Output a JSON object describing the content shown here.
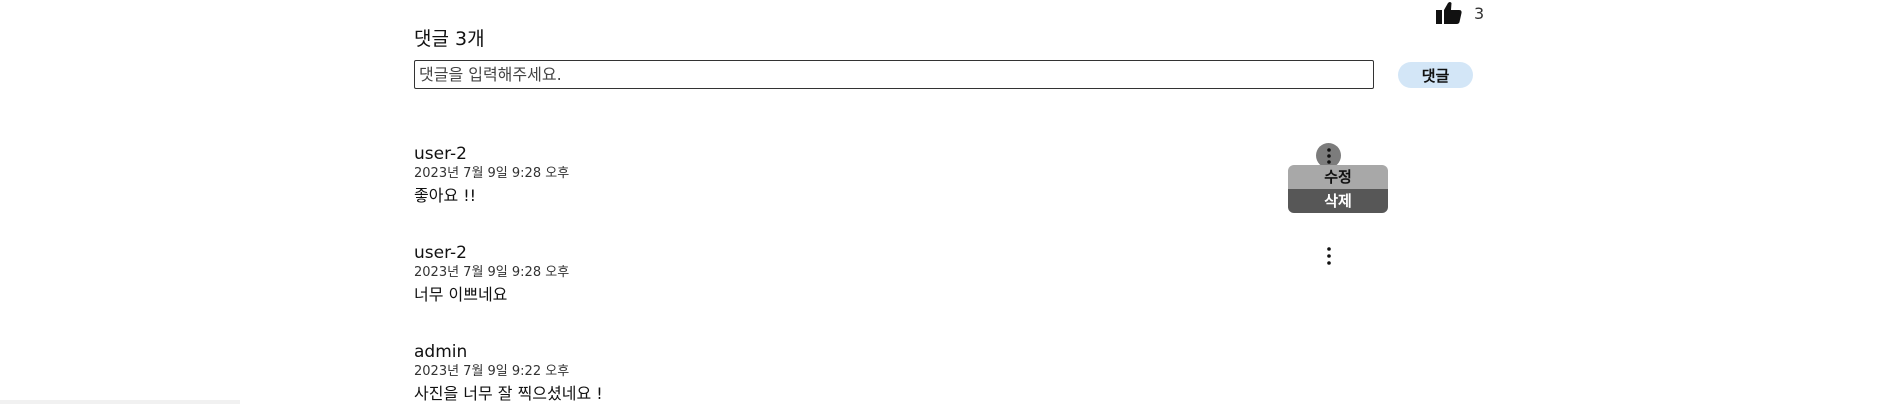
{
  "post": {
    "like_count": "3",
    "like_icon": "thumbs-up-icon"
  },
  "comments_section": {
    "count_label": "댓글 3개",
    "input": {
      "placeholder": "댓글을 입력해주세요.",
      "value": ""
    },
    "submit_label": "댓글"
  },
  "comments": [
    {
      "author": "user-2",
      "date": "2023년 7월 9일 9:28 오후",
      "body": "좋아요 !!",
      "menu_open": true
    },
    {
      "author": "user-2",
      "date": "2023년 7월 9일 9:28 오후",
      "body": "너무 이쁘네요",
      "menu_open": false
    },
    {
      "author": "admin",
      "date": "2023년 7월 9일 9:22 오후",
      "body": "사진을 너무 잘 찍으셨네요 !"
    }
  ],
  "comment_menu": {
    "icon": "more-vertical-icon",
    "edit_label": "수정",
    "delete_label": "삭제"
  },
  "colors": {
    "submit_bg": "#d3e6f7",
    "menu_active": "#7c7c7c",
    "edit_bg": "#a8a8a8",
    "delete_bg": "#575757"
  }
}
